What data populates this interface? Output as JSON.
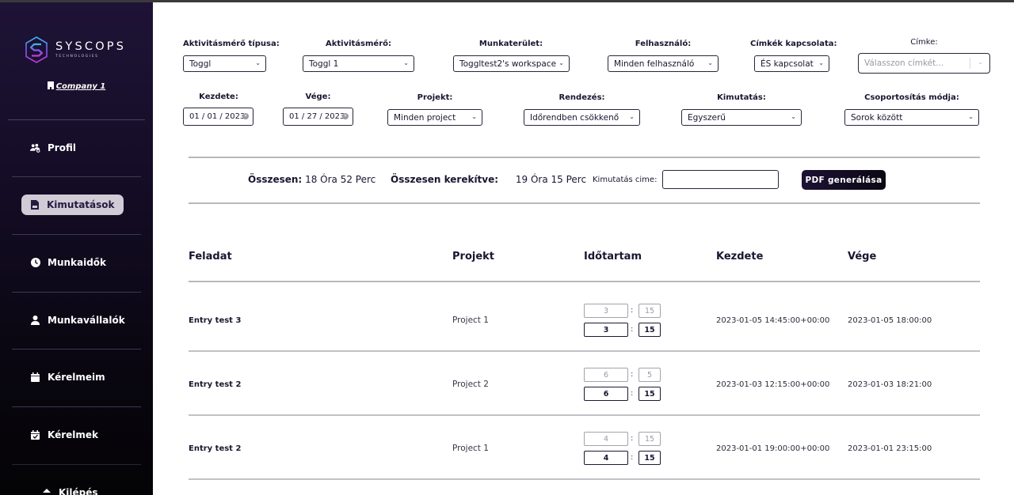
{
  "sidebar": {
    "logo": {
      "name": "SYSCOPS",
      "sub": "TECHNOLOGIES"
    },
    "company": "Company 1",
    "items": [
      {
        "label": "Profil",
        "icon": "users-gear-icon",
        "active": false
      },
      {
        "label": "Kimutatások",
        "icon": "pdf-file-icon",
        "active": true
      },
      {
        "label": "Munkaidők",
        "icon": "clock-icon",
        "active": false
      },
      {
        "label": "Munkavállalók",
        "icon": "user-icon",
        "active": false
      },
      {
        "label": "Kérelmeim",
        "icon": "calendar-icon",
        "active": false
      },
      {
        "label": "Kérelmek",
        "icon": "calendar-check-icon",
        "active": false
      },
      {
        "label": "Kilépés",
        "icon": "logout-icon",
        "active": false
      }
    ]
  },
  "filters": {
    "tracker_type": {
      "label": "Aktivitásmérő típusa:",
      "value": "Toggl"
    },
    "tracker": {
      "label": "Aktivitásmérő:",
      "value": "Toggl 1"
    },
    "workspace": {
      "label": "Munkaterület:",
      "value": "Toggltest2's workspace"
    },
    "user": {
      "label": "Felhasználó:",
      "value": "Minden felhasználó"
    },
    "tag_relation": {
      "label": "Címkék kapcsolata:",
      "value": "ÉS kapcsolat"
    },
    "tag": {
      "label": "Címke:",
      "placeholder": "Válasszon címkét..."
    },
    "start": {
      "label": "Kezdete:",
      "value": "01 / 01 / 2023"
    },
    "end": {
      "label": "Vége:",
      "value": "01 / 27 / 2023"
    },
    "project": {
      "label": "Projekt:",
      "value": "Minden project"
    },
    "sort": {
      "label": "Rendezés:",
      "value": "Időrendben csökkenő"
    },
    "report": {
      "label": "Kimutatás:",
      "value": "Egyszerű"
    },
    "grouping": {
      "label": "Csoportosítás módja:",
      "value": "Sorok között"
    }
  },
  "summary": {
    "total_label": "Összesen:",
    "total_value": "18 Óra 52 Perc",
    "rounded_label": "Összesen kerekítve:",
    "rounded_value": "19 Óra 15 Perc",
    "title_label": "Kimutatás cime:",
    "title_value": "",
    "pdf_button": "PDF generálása"
  },
  "table": {
    "headers": [
      "Feladat",
      "Projekt",
      "Időtartam",
      "Kezdete",
      "Vége"
    ],
    "rows": [
      {
        "task": "Entry test 3",
        "project": "Project 1",
        "orig_h": "3",
        "orig_m": "15",
        "round_h": "3",
        "round_m": "15",
        "start": "2023-01-05 14:45:00+00:00",
        "end": "2023-01-05 18:00:00"
      },
      {
        "task": "Entry test 2",
        "project": "Project 2",
        "orig_h": "6",
        "orig_m": "5",
        "round_h": "6",
        "round_m": "15",
        "start": "2023-01-03 12:15:00+00:00",
        "end": "2023-01-03 18:21:00"
      },
      {
        "task": "Entry test 2",
        "project": "Project 1",
        "orig_h": "4",
        "orig_m": "15",
        "round_h": "4",
        "round_m": "15",
        "start": "2023-01-01 19:00:00+00:00",
        "end": "2023-01-01 23:15:00"
      }
    ],
    "colon": ":"
  }
}
